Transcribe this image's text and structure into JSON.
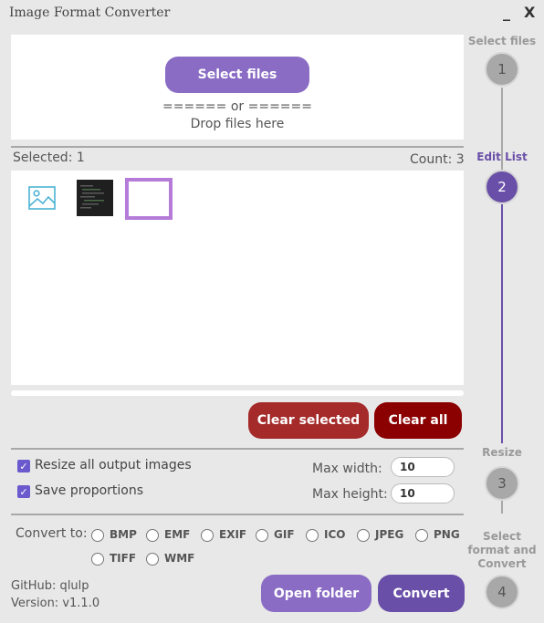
{
  "window": {
    "title": "Image Format Converter",
    "minimize": "_",
    "close": "X"
  },
  "drop": {
    "select_label": "Select files",
    "or_text": "====== or ======",
    "drop_text": "Drop files here"
  },
  "list": {
    "selected": "Selected: 1",
    "count": "Count: 3"
  },
  "actions": {
    "clear_selected": "Clear selected",
    "clear_all": "Clear all"
  },
  "resize": {
    "resize_all": {
      "label": "Resize all output images",
      "checked": true
    },
    "save_proportions": {
      "label": "Save proportions",
      "checked": true
    },
    "max_width_label": "Max width:",
    "max_width": "10",
    "max_height_label": "Max height:",
    "max_height": "10"
  },
  "convert": {
    "label": "Convert to:",
    "formats": [
      "BMP",
      "EMF",
      "EXIF",
      "GIF",
      "ICO",
      "JPEG",
      "PNG",
      "TIFF",
      "WMF"
    ]
  },
  "footer": {
    "github": "GitHub: qlulp",
    "version": "Version: v1.1.0",
    "open_folder": "Open folder",
    "convert": "Convert"
  },
  "steps": [
    {
      "label": "Select files",
      "num": "1"
    },
    {
      "label": "Edit List",
      "num": "2"
    },
    {
      "label": "Resize",
      "num": "3"
    },
    {
      "label": "Select format and Convert",
      "num": "4"
    }
  ],
  "colors": {
    "accent": "#6a4fa8",
    "button_purple": "#8a6cc4",
    "danger": "#a52a2a",
    "danger_dark": "#8b0000"
  }
}
